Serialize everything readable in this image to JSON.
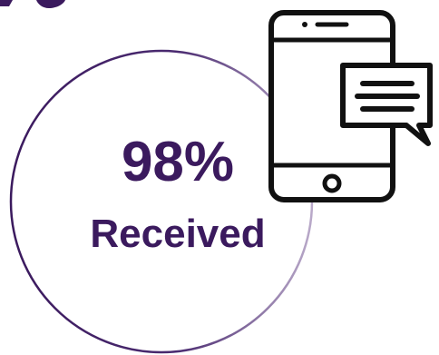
{
  "stat": {
    "value": "98%",
    "label": "Received"
  },
  "icons": {
    "phone": "smartphone-message-icon",
    "bubble": "chat-bubble-icon"
  },
  "colors": {
    "accent": "#3b1a5e",
    "icon": "#111111",
    "background": "#ffffff"
  }
}
